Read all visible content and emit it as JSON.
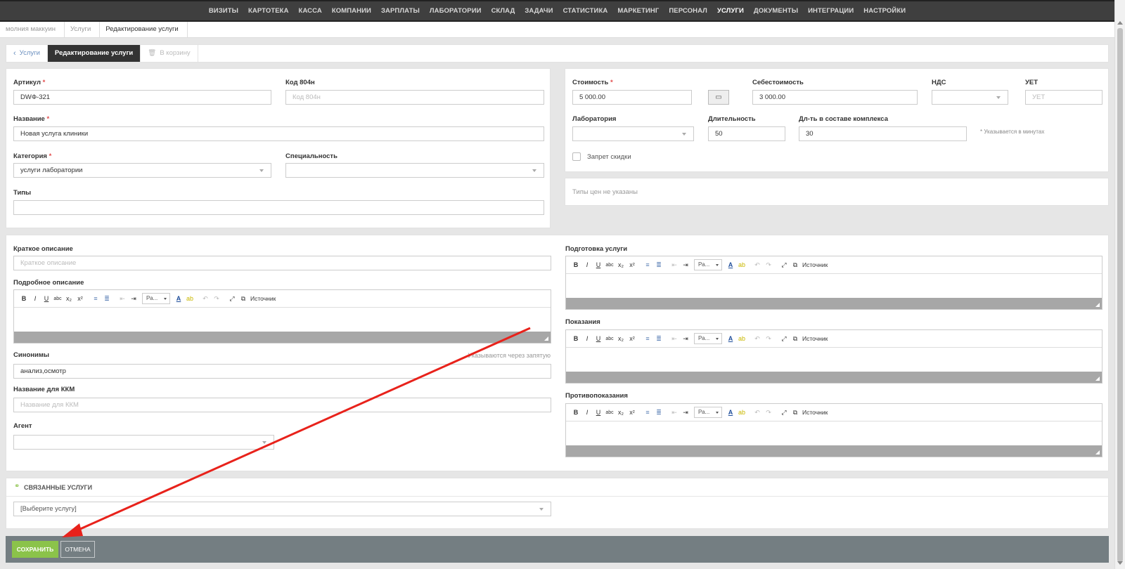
{
  "topnav": {
    "items": [
      "ВИЗИТЫ",
      "КАРТОТЕКА",
      "КАССА",
      "КОМПАНИИ",
      "ЗАРПЛАТЫ",
      "ЛАБОРАТОРИИ",
      "СКЛАД",
      "ЗАДАЧИ",
      "СТАТИСТИКА",
      "МАРКЕТИНГ",
      "ПЕРСОНАЛ",
      "УСЛУГИ",
      "ДОКУМЕНТЫ",
      "ИНТЕГРАЦИИ",
      "НАСТРОЙКИ"
    ],
    "active_index": 11
  },
  "breadcrumb": [
    "молния маккуин",
    "Услуги",
    "Редактирование услуги"
  ],
  "tabs": {
    "back": "Услуги",
    "edit": "Редактирование услуги",
    "trash": "В корзину"
  },
  "form": {
    "article": {
      "label": "Артикул",
      "value": "DWФ-321"
    },
    "code804": {
      "label": "Код 804н",
      "placeholder": "Код 804н"
    },
    "name": {
      "label": "Название",
      "value": "Новая услуга клиники"
    },
    "category": {
      "label": "Категория",
      "value": "услуги лаборатории"
    },
    "speciality": {
      "label": "Специальность",
      "value": ""
    },
    "types": {
      "label": "Типы",
      "value": ""
    },
    "cost": {
      "label": "Стоимость",
      "value": "5 000.00"
    },
    "selfcost": {
      "label": "Себестоимость",
      "value": "3 000.00"
    },
    "vat": {
      "label": "НДС",
      "value": ""
    },
    "uet": {
      "label": "УЕТ",
      "placeholder": "УЕТ"
    },
    "laboratory": {
      "label": "Лаборатория",
      "value": ""
    },
    "duration": {
      "label": "Длительность",
      "value": "50"
    },
    "complex_duration": {
      "label": "Дл-ть в составе комплекса",
      "value": "30"
    },
    "minutes_note": "* Указывается в минутах",
    "no_discount": "Запрет скидки",
    "price_types_empty": "Типы цен не указаны",
    "short_desc": {
      "label": "Краткое описание",
      "placeholder": "Краткое описание"
    },
    "full_desc": {
      "label": "Подробное описание"
    },
    "synonyms": {
      "label": "Синонимы",
      "value": "анализ,осмотр",
      "hint": "Указываются через запятую"
    },
    "kkm_name": {
      "label": "Название для ККМ",
      "placeholder": "Название для ККМ"
    },
    "agent": {
      "label": "Агент",
      "value": ""
    },
    "preparation": {
      "label": "Подготовка услуги"
    },
    "indications": {
      "label": "Показания"
    },
    "contraindications": {
      "label": "Противопоказания"
    }
  },
  "editor": {
    "font_select": "Ра...",
    "source": "Источник"
  },
  "related": {
    "title": "СВЯЗАННЫЕ УСЛУГИ",
    "select_placeholder": "[Выберите услугу]"
  },
  "actions": {
    "save": "СОХРАНИТЬ",
    "cancel": "ОТМЕНА"
  },
  "colors": {
    "nav_bg": "#3f3f3f",
    "save_green": "#8bc34a",
    "bottom_bar": "#747e82",
    "required": "#e24c4c",
    "arrow": "#e8221b"
  }
}
